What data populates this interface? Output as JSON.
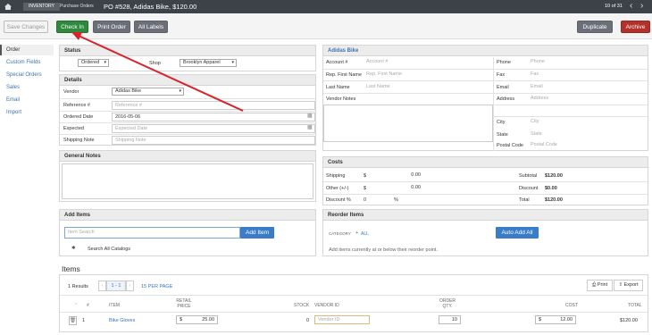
{
  "topbar": {
    "section": "INVENTORY",
    "subsection": "Purchase Orders",
    "title": "PO #528, Adidas Bike, $120.00",
    "pager": "10 of 31",
    "prev": "‹",
    "next": "›"
  },
  "toolbar": {
    "save": "Save Changes",
    "checkin": "Check In",
    "print_order": "Print Order",
    "all_labels": "All Labels",
    "duplicate": "Duplicate",
    "archive": "Archive"
  },
  "sidebar": {
    "items": [
      {
        "label": "Order"
      },
      {
        "label": "Custom Fields"
      },
      {
        "label": "Special Orders"
      },
      {
        "label": "Sales"
      },
      {
        "label": "Email"
      },
      {
        "label": "Import"
      }
    ]
  },
  "status": {
    "header": "Status",
    "status_value": "Ordered",
    "shop_label": "Shop",
    "shop_value": "Brooklyn Apparel"
  },
  "details": {
    "header": "Details",
    "vendor_label": "Vendor",
    "vendor_value": "Adidas Bike",
    "reference_label": "Reference #",
    "reference_placeholder": "Reference #",
    "ordered_label": "Ordered Date",
    "ordered_value": "2016-05-06",
    "expected_label": "Expected",
    "expected_placeholder": "Expected Date",
    "shipping_label": "Shipping Note",
    "shipping_placeholder": "Shipping Note"
  },
  "notes": {
    "header": "General Notes"
  },
  "vendor_panel": {
    "header": "Adidas Bike",
    "account_label": "Account #",
    "account_placeholder": "Account #",
    "rep_label": "Rep. First Name",
    "rep_placeholder": "Rep. First Name",
    "last_label": "Last Name",
    "last_placeholder": "Last Name",
    "vnotes_label": "Vendor Notes",
    "phone_label": "Phone",
    "phone_placeholder": "Phone",
    "fax_label": "Fax",
    "fax_placeholder": "Fax",
    "email_label": "Email",
    "email_placeholder": "Email",
    "address_label": "Address",
    "address_placeholder": "Address",
    "city_label": "City",
    "city_placeholder": "City",
    "state_label": "State",
    "state_placeholder": "State",
    "postal_label": "Postal Code",
    "postal_placeholder": "Postal Code"
  },
  "costs": {
    "header": "Costs",
    "shipping_label": "Shipping",
    "shipping_currency": "$",
    "shipping_value": "0.00",
    "other_label": "Other (+/-)",
    "other_currency": "$",
    "other_value": "0.00",
    "discount_label": "Discount %",
    "discount_prefix": "0",
    "discount_suffix": "%",
    "subtotal_label": "Subtotal",
    "subtotal_value": "$120.00",
    "discount_total_label": "Discount",
    "discount_total_value": "$0.00",
    "total_label": "Total",
    "total_value": "$120.00"
  },
  "add_items": {
    "header": "Add Items",
    "search_placeholder": "Item Search",
    "add_button": "Add Item",
    "search_all": "Search All Catalogs"
  },
  "reorder": {
    "header": "Reorder Items",
    "category_label": "CATEGORY",
    "category_value": "ALL",
    "auto_add": "Auto Add All",
    "hint": "Add items currently at or below their reorder point."
  },
  "items": {
    "title": "Items",
    "results": "1 Results",
    "page": "1 - 1",
    "per_page": "15 PER PAGE",
    "print": "Print",
    "export": "Export",
    "headers": {
      "num": "#",
      "item": "ITEM",
      "retail": "RETAIL PRICE",
      "stock": "STOCK",
      "vendor_id": "VENDOR ID",
      "order_qty": "ORDER QTY.",
      "cost": "COST",
      "total": "TOTAL"
    },
    "rows": [
      {
        "num": "1",
        "item": "Bike Gloves",
        "retail_currency": "$",
        "retail": "25.00",
        "stock": "0",
        "vendor_id_placeholder": "Vendor ID",
        "order_qty": "10",
        "cost_currency": "$",
        "cost": "12.00",
        "total": "$120.00"
      }
    ]
  },
  "colors": {
    "topbar": "#3d4148",
    "checkin": "#2f8a3e",
    "archive": "#b3302b",
    "link": "#3b73b8",
    "annotation_arrow": "#d8232a"
  }
}
